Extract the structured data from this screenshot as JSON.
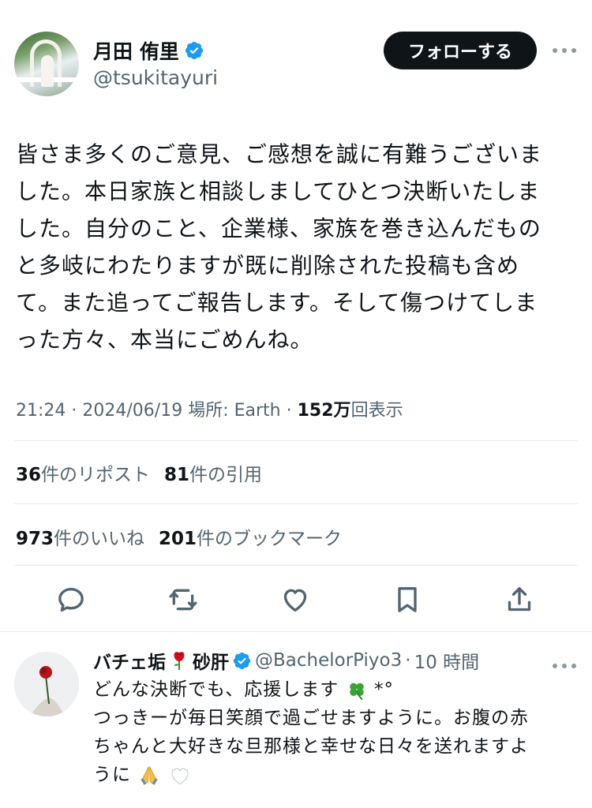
{
  "author": {
    "display_name": "月田 侑里",
    "handle": "@tsukitayuri",
    "verified": true,
    "follow_label": "フォローする"
  },
  "tweet": {
    "text": "皆さま多くのご意見、ご感想を誠に有難うございました。本日家族と相談しましてひとつ決断いたしました。自分のこと、企業様、家族を巻き込んだものと多岐にわたりますが既に削除された投稿も含めて。また追ってご報告します。そして傷つけてしまった方々、本当にごめんね。",
    "lines": [
      "皆さま多くのご意見、ご感想を誠に有難うございま",
      "した。本日家族と相談しましてひとつ決断いたしま",
      "した。自分のこと、企業様、家族を巻き込んだもの",
      "と多岐にわたりますが既に削除された投稿も含め",
      "て。また追ってご報告します。そして傷つけてしま",
      "った方々、本当にごめんね。"
    ],
    "time": "21:24",
    "date": "2024/06/19",
    "location": "場所: Earth",
    "views_count": "152万",
    "views_label": "回表示",
    "separator": "·"
  },
  "stats": {
    "reposts_count": "36",
    "reposts_label": "件のリポスト",
    "quotes_count": "81",
    "quotes_label": "件の引用",
    "likes_count": "973",
    "likes_label": "件のいいね",
    "bookmarks_count": "201",
    "bookmarks_label": "件のブックマーク"
  },
  "actions": {
    "icons": [
      "reply-icon",
      "repost-icon",
      "like-icon",
      "bookmark-icon",
      "share-icon"
    ]
  },
  "reply": {
    "name_part1": "バチェ垢",
    "name_part2": "砂肝",
    "handle": "@BachelorPiyo3",
    "separator": "·",
    "time": "10 時間",
    "line1": "どんな決断でも、応援します",
    "line1_suffix": "*°",
    "line2": "つっきーが毎日笑顔で過ごせますように。お腹の赤",
    "line3": "ちゃんと大好きな旦那様と幸せな日々を送れますよ",
    "line4": "うに"
  },
  "colors": {
    "text": "#0f1419",
    "muted": "#536471",
    "verified": "#1d9bf0",
    "divider": "#e6ebee",
    "follow_bg": "#0f1419"
  }
}
